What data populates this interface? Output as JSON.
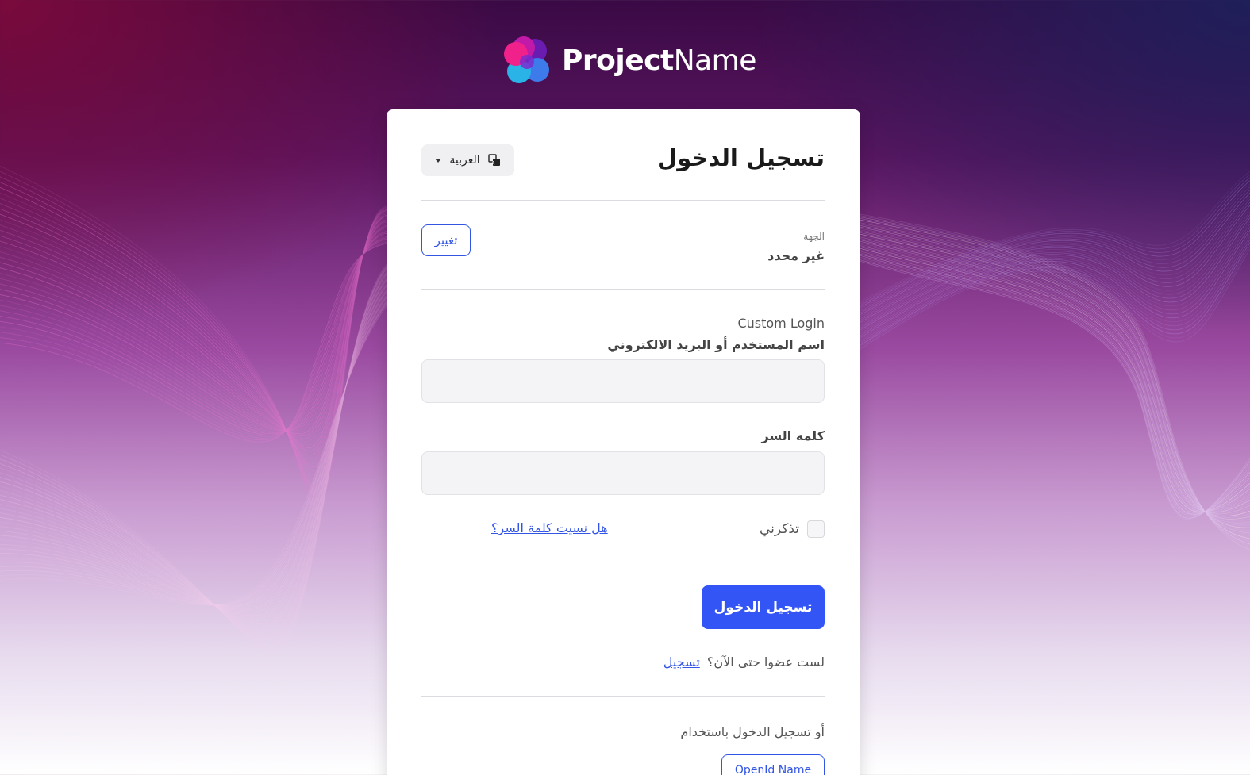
{
  "brand": {
    "name_bold": "Project",
    "name_regular": "Name"
  },
  "login": {
    "title": "تسجيل الدخول",
    "language_label": "العربية",
    "tenant_label": "الجهة",
    "tenant_value": "غير محدد",
    "change_button": "تغيير",
    "custom_login": "Custom Login",
    "username_label": "اسم المستخدم أو البريد الالكتروني",
    "username_value": "",
    "password_label": "كلمه السر",
    "password_value": "",
    "remember_me": "تذكرني",
    "forgot_password": "هل نسيت كلمة السر؟",
    "submit_button": "تسجيل الدخول",
    "not_member": "لست عضوا حتى الآن؟",
    "register_link": "تسجيل",
    "or_login_with": "أو تسجيل الدخول باستخدام",
    "openid_button": "OpenId Name"
  },
  "colors": {
    "primary": "#3355f5",
    "logo_pink": "#f0218a",
    "logo_purple": "#6a1bb0",
    "logo_blue": "#3d7bea",
    "logo_cyan": "#2ab3e6"
  }
}
